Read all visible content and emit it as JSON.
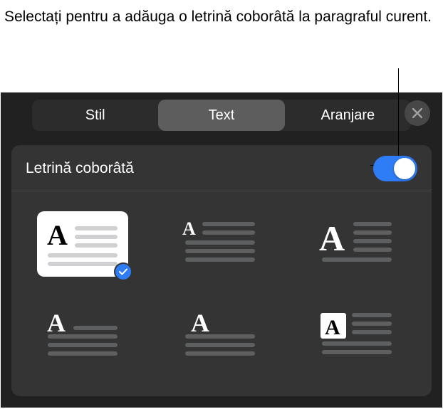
{
  "callout": {
    "text": "Selectați pentru a adăuga o letrină coborâtă la paragraful curent."
  },
  "tabs": {
    "style": "Stil",
    "text": "Text",
    "arrange": "Aranjare"
  },
  "section": {
    "title": "Letrină coborâtă",
    "toggle_on": true
  },
  "options": [
    {
      "name": "dropcap-option-1",
      "selected": true
    },
    {
      "name": "dropcap-option-2",
      "selected": false
    },
    {
      "name": "dropcap-option-3",
      "selected": false
    },
    {
      "name": "dropcap-option-4",
      "selected": false
    },
    {
      "name": "dropcap-option-5",
      "selected": false
    },
    {
      "name": "dropcap-option-6",
      "selected": false
    }
  ],
  "icons": {
    "close": "close-icon",
    "check": "check-icon"
  }
}
